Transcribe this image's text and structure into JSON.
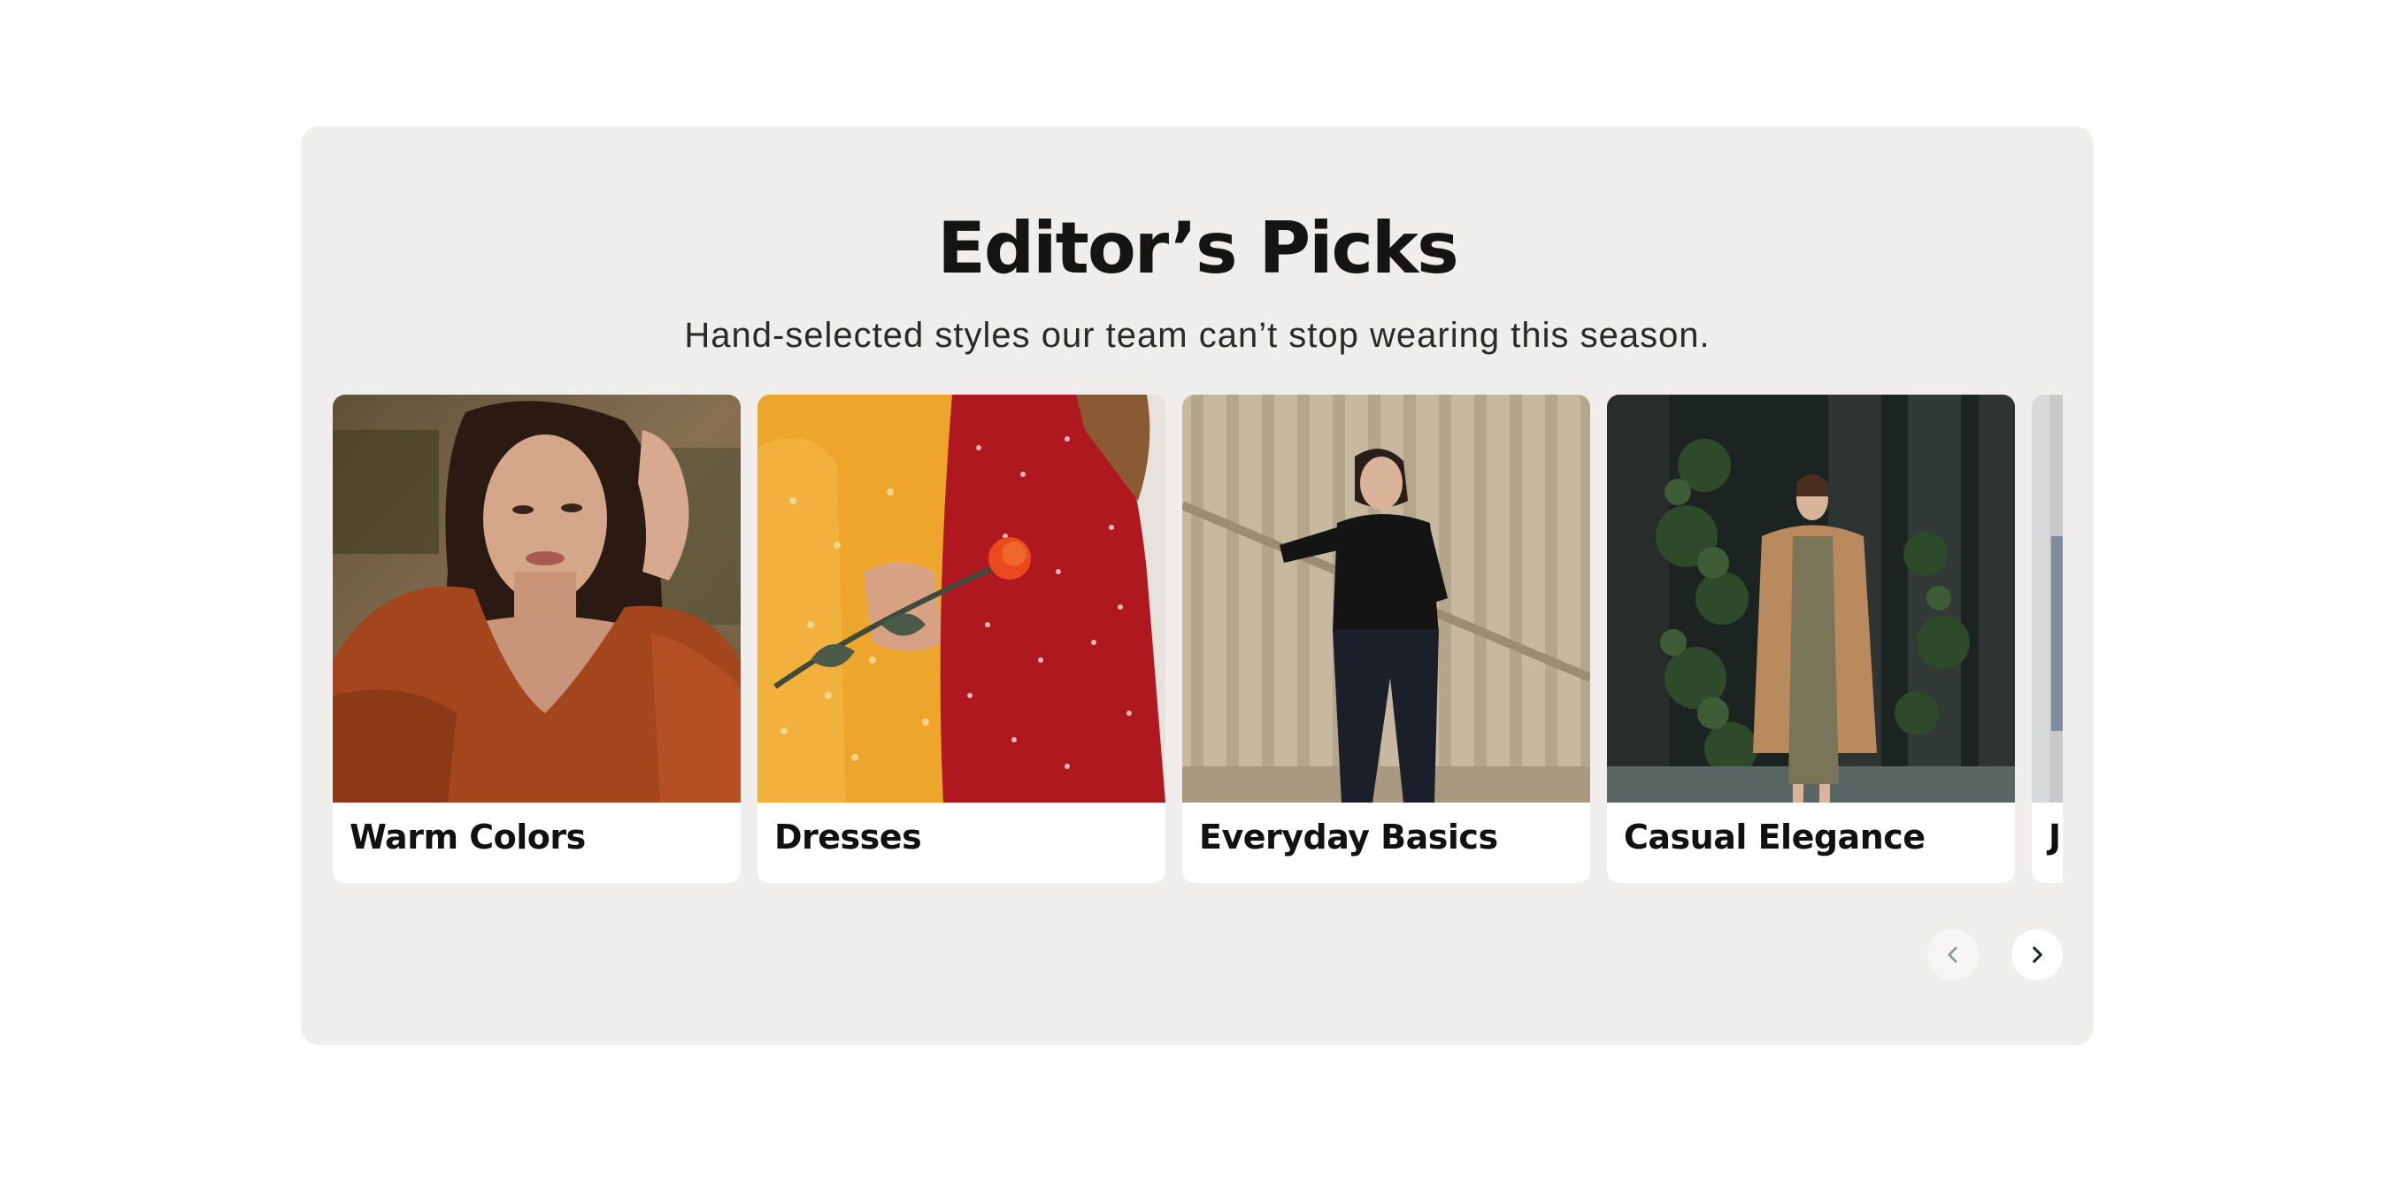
{
  "section": {
    "title": "Editor’s Picks",
    "subtitle": "Hand-selected styles our team can’t stop wearing this season."
  },
  "cards": [
    {
      "label": "Warm Colors",
      "image": "woman-rust-blouse-photo"
    },
    {
      "label": "Dresses",
      "image": "two-dresses-with-rose-photo"
    },
    {
      "label": "Everyday Basics",
      "image": "woman-black-outfit-stairs-photo"
    },
    {
      "label": "Casual Elegance",
      "image": "woman-camel-coat-photo"
    },
    {
      "label": "J",
      "image": "partial-card-photo"
    }
  ],
  "navigation": {
    "prev_icon": "chevron-left-icon",
    "next_icon": "chevron-right-icon"
  },
  "colors": {
    "section_background": "#f0eded",
    "card_background": "#ffffff",
    "text_primary": "#141414"
  }
}
